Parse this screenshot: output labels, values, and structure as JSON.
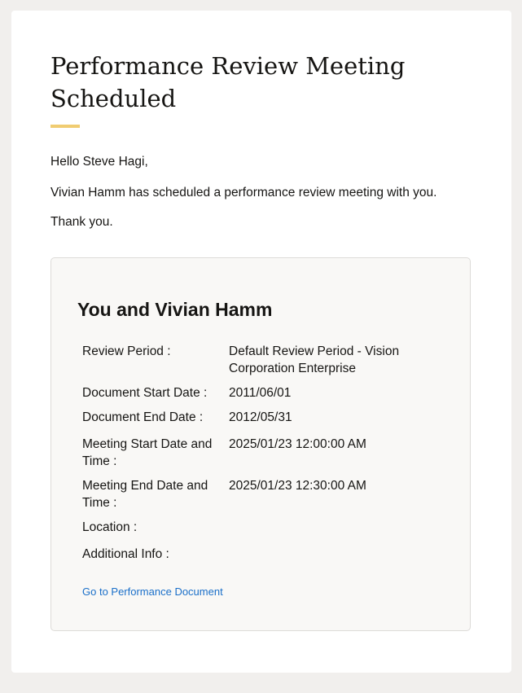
{
  "title": "Performance Review Meeting Scheduled",
  "greeting": "Hello Steve Hagi,",
  "message": "Vivian Hamm has scheduled a performance review meeting with you.",
  "closing": "Thank you.",
  "panel": {
    "heading": "You and Vivian Hamm",
    "rows": [
      {
        "label": "Review Period :",
        "value": "Default Review Period - Vision Corporation Enterprise"
      },
      {
        "label": "Document Start Date :",
        "value": "2011/06/01"
      },
      {
        "label": "Document End Date :",
        "value": "2012/05/31"
      },
      {
        "label": "Meeting Start Date and Time :",
        "value": "2025/01/23 12:00:00 AM"
      },
      {
        "label": "Meeting End Date and Time :",
        "value": "2025/01/23 12:30:00 AM"
      },
      {
        "label": "Location :",
        "value": ""
      },
      {
        "label": "Additional Info :",
        "value": ""
      }
    ],
    "link": "Go to Performance Document"
  },
  "colors": {
    "accent": "#f0cc71",
    "link": "#1a6fc9"
  }
}
